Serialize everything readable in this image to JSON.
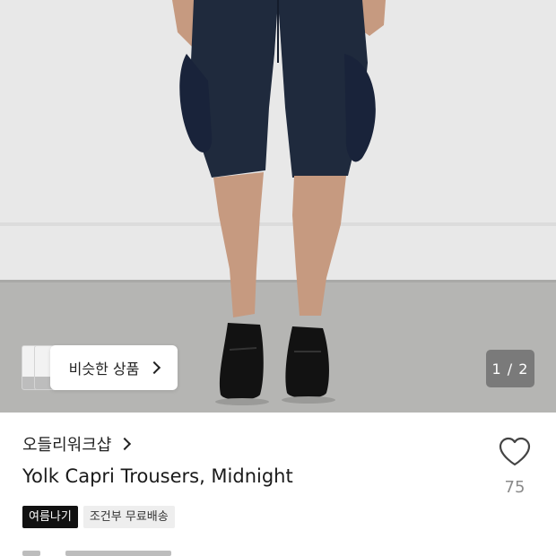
{
  "hero": {
    "image_alt": "Yolk Capri Trousers, Midnight",
    "similar_products_label": "비슷한 상품",
    "page_counter": "1 / 2",
    "colors": {
      "wall": "#e7e7e7",
      "floor": "#b5b5b3",
      "trousers": "#1f2a3d",
      "skin": "#c69a80",
      "shoes": "#121212"
    }
  },
  "product": {
    "brand": "오들리워크샵",
    "title": "Yolk Capri Trousers, Midnight",
    "tags": [
      {
        "label": "여름나기",
        "style": "dark"
      },
      {
        "label": "조건부 무료배송",
        "style": "light"
      }
    ],
    "likes": "75"
  },
  "icons": {
    "similar_chevron": "chevron-right-icon",
    "brand_chevron": "chevron-right-icon",
    "like": "heart-outline-icon"
  }
}
